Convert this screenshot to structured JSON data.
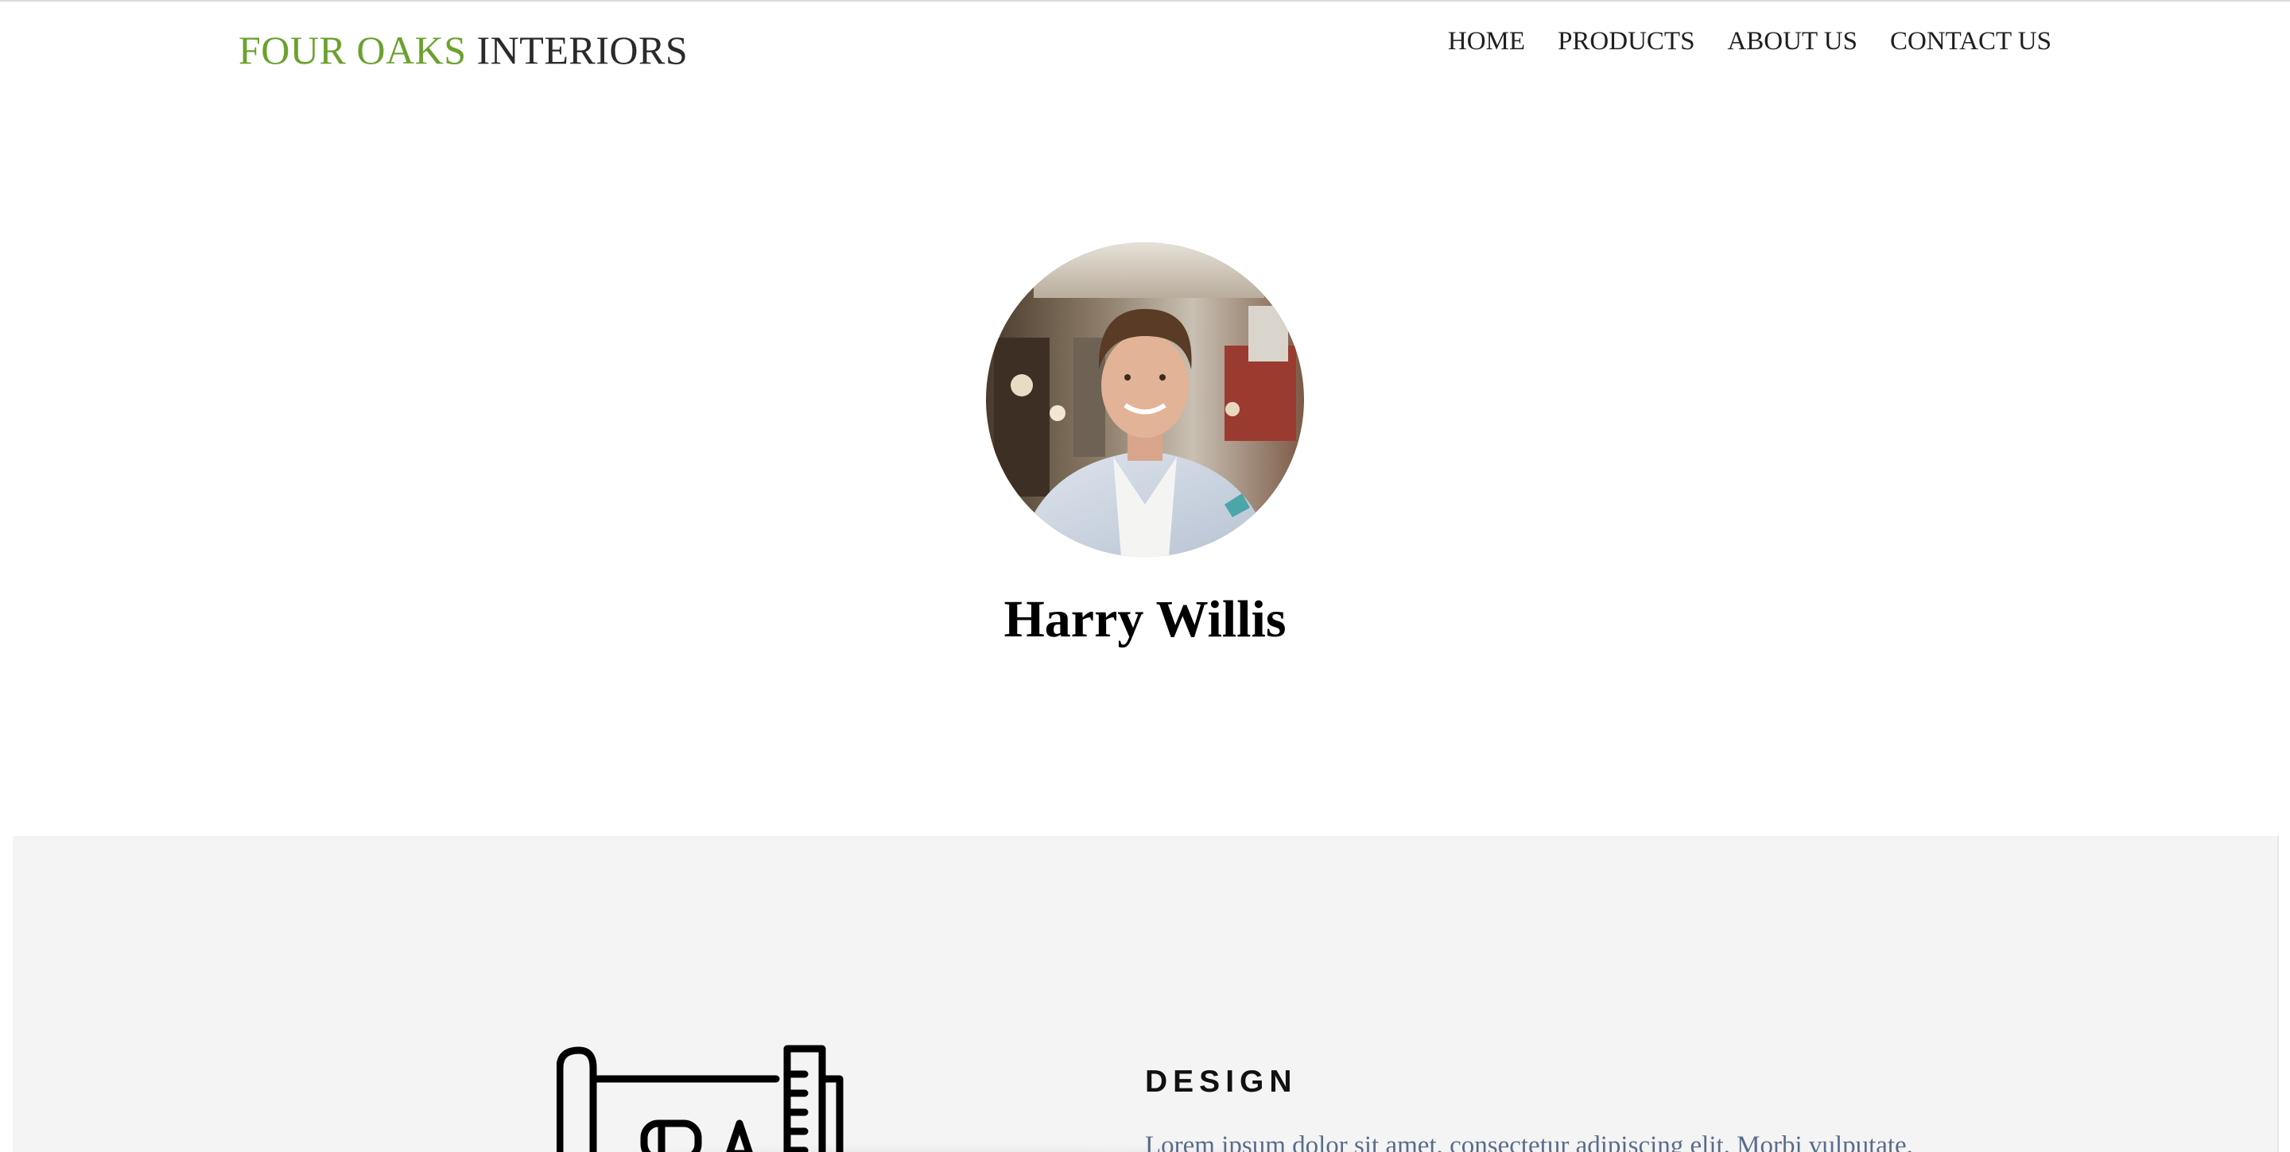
{
  "header": {
    "brand_accent": "FOUR OAKS",
    "brand_rest": "INTERIORS",
    "nav": [
      "HOME",
      "PRODUCTS",
      "ABOUT US",
      "CONTACT US"
    ]
  },
  "profile": {
    "name": "Harry Willis"
  },
  "feature": {
    "icon": "design-blueprint-icon",
    "title": "DESIGN",
    "text": "Lorem ipsum dolor sit amet, consectetur adipiscing elit. Morbi vulputate,"
  },
  "colors": {
    "brand_green": "#6aa22d",
    "section_bg": "#f4f4f4",
    "body_text": "#5a6b8a"
  }
}
